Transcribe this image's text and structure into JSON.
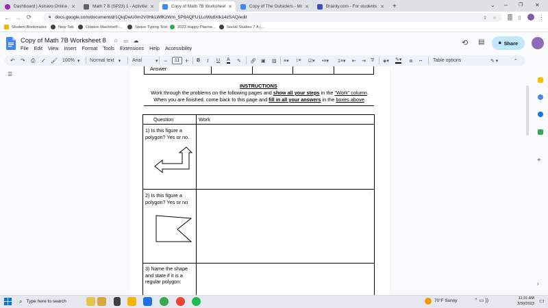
{
  "browser": {
    "tabs": [
      {
        "title": "Dashboard | Astravo Online Aca...",
        "color": "#9c27b0"
      },
      {
        "title": "Math 7 B (SP23) 1 - Activities",
        "color": "#5f6368"
      },
      {
        "title": "Copy of Math 7B Worksheet 8 -",
        "color": "#4285f4"
      },
      {
        "title": "Copy of The Outsiders - Moderni",
        "color": "#4285f4"
      },
      {
        "title": "Brainly.com - For students. By st",
        "color": "#3f51b5"
      }
    ],
    "new_tab_label": "+",
    "url": "docs.google.com/document/d/1QiqDwU0m2V0HkLWfKzWm_5P8AQFU1LoWo8Xlk14zSAQ/edit",
    "bookmarks": [
      {
        "label": "Student Bookmarks",
        "color": "#f5b400"
      },
      {
        "label": "New Tab",
        "color": "#3c4043"
      },
      {
        "label": "Citation Machine®:...",
        "color": "#3c4043"
      },
      {
        "label": "Space Typing Test",
        "color": "#3c4043"
      },
      {
        "label": "2023 Happy Planne...",
        "color": "#34a853"
      },
      {
        "label": "Social Studies 7 A (...",
        "color": "#3c4043"
      }
    ]
  },
  "docs": {
    "title": "Copy of Math 7B Worksheet 8",
    "menu": [
      "File",
      "Edit",
      "View",
      "Insert",
      "Format",
      "Tools",
      "Extensions",
      "Help",
      "Accessibility"
    ],
    "share_label": "Share",
    "toolbar": {
      "zoom": "100%",
      "style": "Normal text",
      "font": "Arial",
      "font_size": "11",
      "table_options": "Table options"
    }
  },
  "document": {
    "prev_table_label": "Answer",
    "instructions_heading": "INSTRUCTIONS",
    "instr_line1": {
      "a": "Work through the problems on the following pages and ",
      "b": "show all your steps",
      "c": " in the ",
      "d": "“Work” column",
      "e": "."
    },
    "instr_line2": {
      "a": "When you are finished, come back to this page and ",
      "b": "fill in all your answers",
      "c": " in the ",
      "d": "boxes above",
      "e": "."
    },
    "table_headers": [
      "Question",
      "Work"
    ],
    "questions": [
      "1)  Is this figure a polygon? Yes or no.",
      "2) Is this figure a polygon? Yes or no",
      "3) Name the shape and state if it is a regular polygon:"
    ]
  },
  "taskbar": {
    "search_placeholder": "Type here to search",
    "weather": "70°F  Sunny",
    "time": "11:31 AM",
    "date": "3/30/2023"
  }
}
